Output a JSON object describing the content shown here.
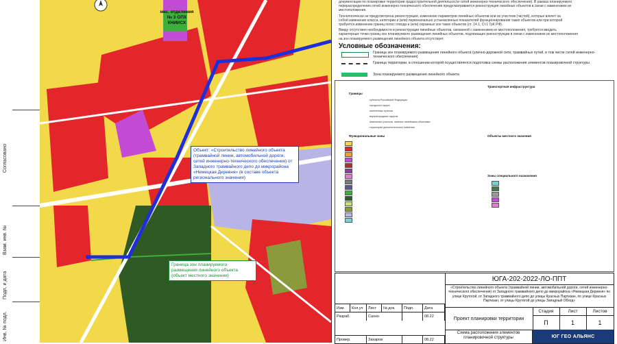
{
  "map": {
    "district_label": "мкс. отделения\n№ 3 ОПХ\nКНИИСХ",
    "object_label_blue": "Объект: «Строительство линейного объекта (трамвайной линии, автомобильной дороги, сетей инженерно-технического обеспечения) от Западного трамвайного депо до микрорайона «Немецкая Деревня» (в составе объекта регионального значения)",
    "object_label_green": "Граница зон планируемого размещения линейного объекта (объект местного значения)",
    "colors": {
      "residential_yellow": "#f2d94a",
      "residential_red": "#e3262b",
      "park_green": "#2f5a23",
      "water_lilac": "#b9b4e6",
      "route_blue": "#1f2fd8",
      "road_white": "#ffffff",
      "purple": "#c44bd6"
    }
  },
  "left_strip": {
    "labels": [
      "Согласовано",
      "Взам. инв. №",
      "Подп. и дата",
      "Инв. № подл."
    ]
  },
  "notes": {
    "line1": "документации по планировке территории градостроительной деятельности сетей инженерно-технического обеспечения). В рамках планируемого",
    "line2": "перераспределения сетей инженерно-технического обеспечения предусматривается реконструкция линейных объектов в связи с изменением их",
    "line3": "местоположения.",
    "line4": "Технологически не предусмотрена реконструкция, изменение параметров линейных объектов или их участков (частей), которые влечет за",
    "line5": "собой изменение класса, категории и (или) первоначально установленных показателей функционирования таких объектов или при которой",
    "line6": "требуется изменение границ полос отвода и (или) охранных зон таких объектов (ст. 14.1, Ст.1 ГрК РФ).",
    "line7": "Ввиду отсутствия необходимости в реконструкции линейных объектов, связанной с изменением их местоположения, требуется вводить",
    "line8": "характерные точки границ зон планируемого размещения линейных объектов, подлежащих реконструкции в связи с изменением их местоположения",
    "line9": "на зон планируемого размещения линейного объекта отсутствует."
  },
  "legend": {
    "title": "Условные обозначения:",
    "items": [
      "Граница зон планируемого размещения линейного объекта (улично-дорожной сети, трамвайных путей, в том числе сетей инженерно-технического обеспечения)",
      "Граница территории, в отношении которой осуществляется подготовка схемы расположения элементов планировочной структуры",
      "Зона планируемого размещения линейного объекта"
    ]
  },
  "big_legend": {
    "col1_head": "Границы",
    "col1_sub": "Функциональные зоны",
    "col1_items": [
      "субъекта Российской Федерации",
      "городского округа",
      "населенных пунктов",
      "внутригородских округов",
      "земельных участков, занятых линейными объектами",
      "территории дополнительного освоения"
    ],
    "col2_head": "Транспортная инфраструктура",
    "col2_sub": "Объекты местного значения",
    "col2_sub2": "Зоны специального назначения"
  },
  "stamp": {
    "code": "ЮГА-202-2022-ЛО-ППТ",
    "description": "«Строительство линейного объекта (трамвайной линии, автомобильной дороги, сетей инженерно-технического обеспечения) от Западного трамвайного депо до микрорайона «Немецкая Деревня» по улице Крутогой, от Западного трамвайного депо до улицы Красных Партизан, по улице Красных Партизан, от улицы Крутогой до улицы Западный Обход»",
    "title": "Проект планировки территории",
    "subtitle": "Схема расположения элементов планировочной структуры",
    "stage_head": "Стадия",
    "sheet_head": "Лист",
    "sheets_head": "Листов",
    "stage": "П",
    "sheet": "1",
    "sheets": "1",
    "company": "ЮГ ГЕО АЛЬЯНС",
    "col_izm": "Изм.",
    "col_kol": "Кол.уч",
    "col_list": "Лист",
    "col_doc": "№ док.",
    "col_sign": "Подп.",
    "col_date": "Дата",
    "row_develop": "Разраб.",
    "dev_name": "Сахно",
    "dev_date": "08.22",
    "row_check": "Провер.",
    "check_name": "Захаров",
    "check_date": "08.22"
  }
}
